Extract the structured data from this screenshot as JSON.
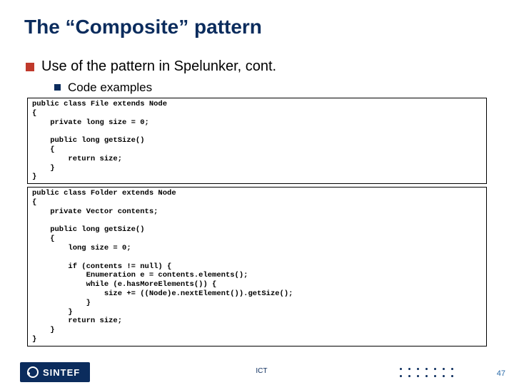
{
  "title": "The “Composite” pattern",
  "bullets": {
    "l1": "Use of the pattern in Spelunker, cont.",
    "l2": "Code examples"
  },
  "code1": "public class File extends Node\n{\n    private long size = 0;\n\n    public long getSize()\n    {\n        return size;\n    }\n}",
  "code2": "public class Folder extends Node\n{\n    private Vector contents;\n\n    public long getSize()\n    {\n        long size = 0;\n\n        if (contents != null) {\n            Enumeration e = contents.elements();\n            while (e.hasMoreElements()) {\n                size += ((Node)e.nextElement()).getSize();\n            }\n        }\n        return size;\n    }\n}",
  "footer": {
    "brand": "SINTEF",
    "ict": "ICT",
    "page": "47"
  }
}
